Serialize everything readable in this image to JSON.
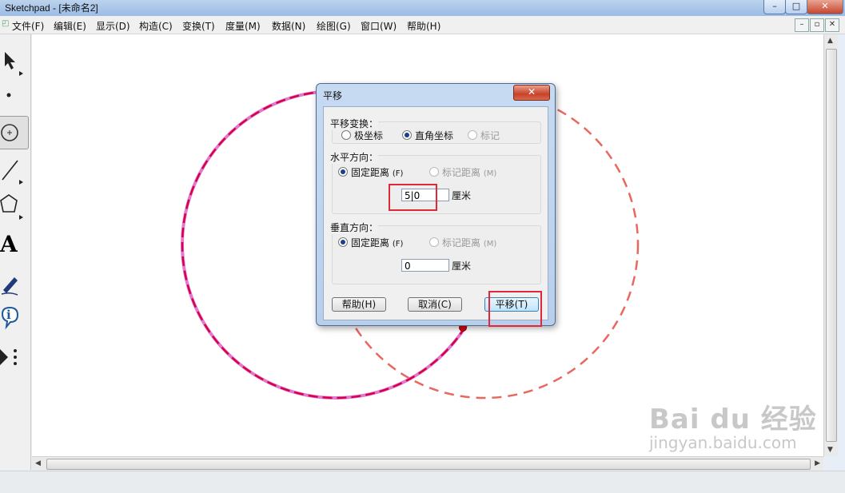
{
  "window": {
    "title": "Sketchpad  - [未命名2]",
    "buttons": [
      "–",
      "□",
      "✕"
    ]
  },
  "menu": {
    "items": [
      "文件(F)",
      "编辑(E)",
      "显示(D)",
      "构造(C)",
      "变换(T)",
      "度量(M)",
      "数据(N)",
      "绘图(G)",
      "窗口(W)",
      "帮助(H)"
    ],
    "mdi_buttons": [
      "–",
      "▫",
      "✕"
    ]
  },
  "toolbox": {
    "tools": [
      "arrow-select-icon",
      "point-icon",
      "compass-circle-icon",
      "straightedge-icon",
      "polygon-icon",
      "text-icon",
      "marker-icon",
      "info-icon",
      "custom-tool-icon"
    ],
    "text_glyph": "A",
    "info_glyph": "i"
  },
  "canvas": {
    "original_circle_color": "#d8004a",
    "translated_circle_color": "#e8685f"
  },
  "dialog": {
    "title": "平移",
    "close": "✕",
    "transform": {
      "legend": "平移变换：",
      "options": [
        "极坐标",
        "直角坐标",
        "标记"
      ],
      "selected": "直角坐标"
    },
    "horizontal": {
      "legend": "水平方向：",
      "fixed_label": "固定距离",
      "fixed_key": "(F)",
      "marked_label": "标记距离",
      "marked_key": "(M)",
      "value": "5|0",
      "unit": "厘米"
    },
    "vertical": {
      "legend": "垂直方向：",
      "fixed_label": "固定距离",
      "fixed_key": "(F)",
      "marked_label": "标记距离",
      "marked_key": "(M)",
      "value": "0",
      "unit": "厘米"
    },
    "buttons": {
      "help": "帮助(H)",
      "cancel": "取消(C)",
      "ok": "平移(T)"
    },
    "highlight_color": "#e0283a"
  },
  "watermark": {
    "line1": "Bai du 经验",
    "line2": "jingyan.baidu.com"
  }
}
